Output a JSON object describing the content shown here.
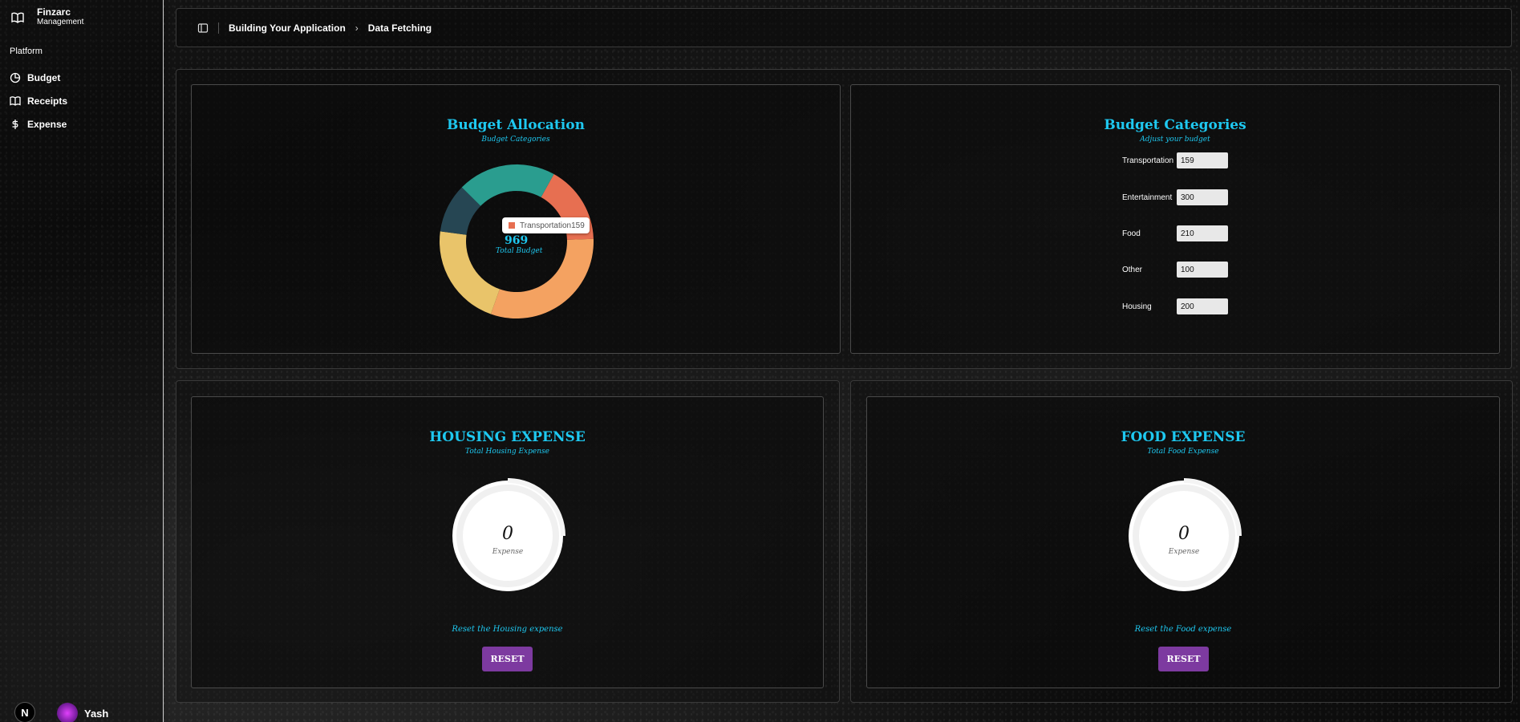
{
  "sidebar": {
    "brand_title": "Finzarc",
    "brand_subtitle": "Management",
    "section_label": "Platform",
    "items": [
      {
        "label": "Budget",
        "icon": "pie-chart-icon"
      },
      {
        "label": "Receipts",
        "icon": "book-icon"
      },
      {
        "label": "Expense",
        "icon": "dollar-icon"
      }
    ],
    "user_name": "Yash",
    "badge_letter": "N"
  },
  "header": {
    "breadcrumb": [
      "Building Your Application",
      "Data Fetching"
    ]
  },
  "budget_allocation": {
    "title": "Budget Allocation",
    "subtitle": "Budget Categories",
    "total": "969",
    "total_label": "Total Budget",
    "tooltip_label": "Transportation",
    "tooltip_value": "159"
  },
  "chart_data": {
    "type": "pie",
    "categories": [
      "Transportation",
      "Entertainment",
      "Food",
      "Other",
      "Housing"
    ],
    "values": [
      159,
      300,
      210,
      100,
      200
    ],
    "colors": [
      "#e76f51",
      "#f4a261",
      "#e9c46a",
      "#264653",
      "#2a9d8f"
    ]
  },
  "budget_categories": {
    "title": "Budget Categories",
    "subtitle": "Adjust your budget",
    "rows": [
      {
        "label": "Transportation",
        "value": "159"
      },
      {
        "label": "Entertainment",
        "value": "300"
      },
      {
        "label": "Food",
        "value": "210"
      },
      {
        "label": "Other",
        "value": "100"
      },
      {
        "label": "Housing",
        "value": "200"
      }
    ]
  },
  "housing": {
    "title": "HOUSING EXPENSE",
    "subtitle": "Total Housing Expense",
    "value": "0",
    "value_label": "Expense",
    "reset_text": "Reset the Housing expense",
    "reset_label": "RESET"
  },
  "food": {
    "title": "FOOD EXPENSE",
    "subtitle": "Total Food Expense",
    "value": "0",
    "value_label": "Expense",
    "reset_text": "Reset the Food expense",
    "reset_label": "RESET"
  },
  "colors": {
    "accent": "#1ec8f0",
    "button": "#7d3aa0"
  }
}
